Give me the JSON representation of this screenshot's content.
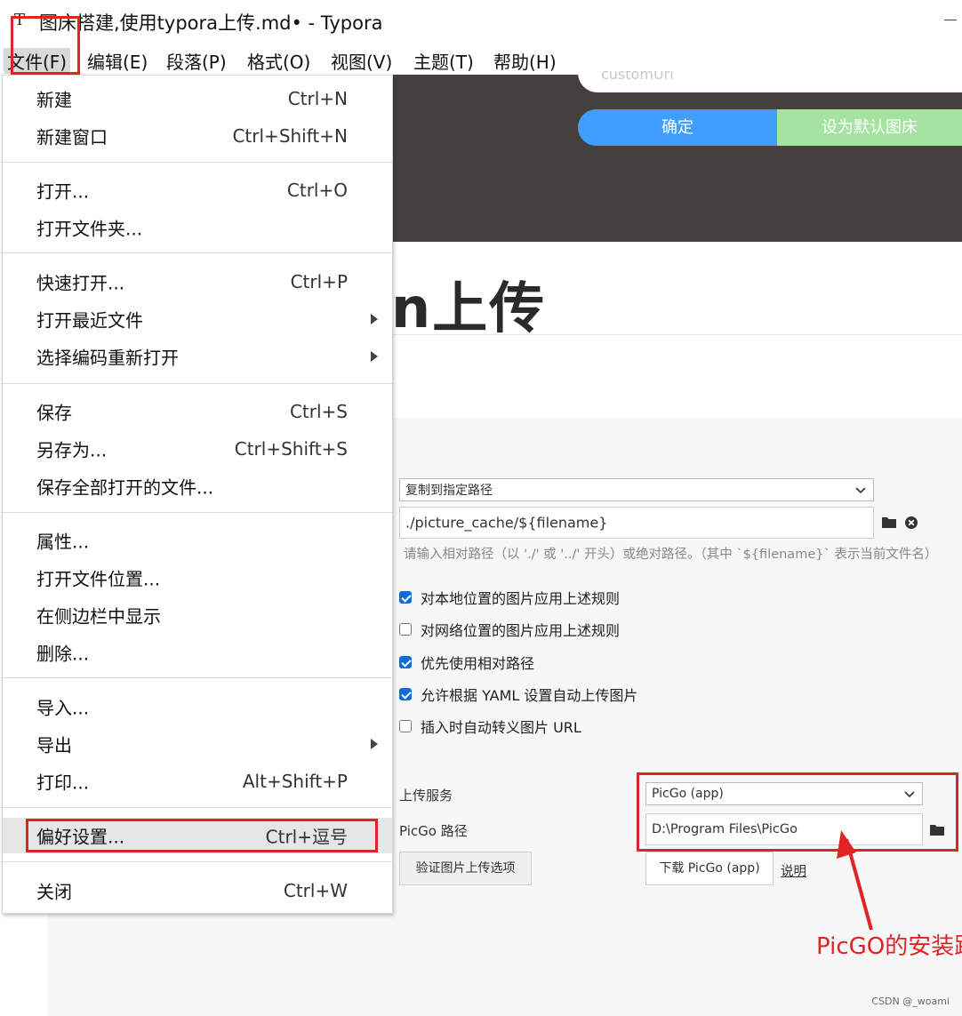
{
  "window": {
    "title": "图床搭建,使用typora上传.md• - Typora",
    "app_icon": "T"
  },
  "menubar": [
    "文件(F)",
    "编辑(E)",
    "段落(P)",
    "格式(O)",
    "视图(V)",
    "主题(T)",
    "帮助(H)"
  ],
  "file_menu": {
    "new": {
      "label": "新建",
      "shortcut": "Ctrl+N"
    },
    "new_window": {
      "label": "新建窗口",
      "shortcut": "Ctrl+Shift+N"
    },
    "open": {
      "label": "打开...",
      "shortcut": "Ctrl+O"
    },
    "open_folder": {
      "label": "打开文件夹..."
    },
    "quick_open": {
      "label": "快速打开...",
      "shortcut": "Ctrl+P"
    },
    "open_recent": {
      "label": "打开最近文件"
    },
    "reopen_encoding": {
      "label": "选择编码重新打开"
    },
    "save": {
      "label": "保存",
      "shortcut": "Ctrl+S"
    },
    "save_as": {
      "label": "另存为...",
      "shortcut": "Ctrl+Shift+S"
    },
    "save_all": {
      "label": "保存全部打开的文件..."
    },
    "properties": {
      "label": "属性..."
    },
    "open_location": {
      "label": "打开文件位置..."
    },
    "reveal_sidebar": {
      "label": "在侧边栏中显示"
    },
    "delete": {
      "label": "删除..."
    },
    "import": {
      "label": "导入..."
    },
    "export": {
      "label": "导出"
    },
    "print": {
      "label": "打印...",
      "shortcut": "Alt+Shift+P"
    },
    "preferences": {
      "label": "偏好设置...",
      "shortcut": "Ctrl+逗号"
    },
    "close": {
      "label": "关闭",
      "shortcut": "Ctrl+W"
    }
  },
  "background": {
    "dark_input_placeholder": "customUrl",
    "confirm_label": "确定",
    "default_label": "设为默认图床",
    "heading": "n上传"
  },
  "prefs": {
    "copy_mode": "复制到指定路径",
    "path_value": "./picture_cache/${filename}",
    "path_hint": "请输入相对路径（以 './' 或 '../' 开头）或绝对路径。（其中 `${filename}` 表示当前文件名）",
    "checkboxes": [
      {
        "label": "对本地位置的图片应用上述规则",
        "checked": true
      },
      {
        "label": "对网络位置的图片应用上述规则",
        "checked": false
      },
      {
        "label": "优先使用相对路径",
        "checked": true
      },
      {
        "label": "允许根据 YAML 设置自动上传图片",
        "checked": true
      },
      {
        "label": "插入时自动转义图片 URL",
        "checked": false
      }
    ],
    "upload_service_label": "上传服务",
    "upload_service_value": "PicGo (app)",
    "picgo_path_label": "PicGo 路径",
    "picgo_path_value": "D:\\Program Files\\PicGo",
    "verify_button": "验证图片上传选项",
    "download_button": "下载 PicGo (app)",
    "help_link": "说明"
  },
  "annotation": {
    "text": "PicGO的安装路",
    "color": "#e02424"
  },
  "watermark": "CSDN @_woami",
  "colors": {
    "accent_blue": "#409eff",
    "accent_green": "#a5e3a1",
    "dark_panel": "#45403e",
    "annotation_red": "#e02424"
  }
}
